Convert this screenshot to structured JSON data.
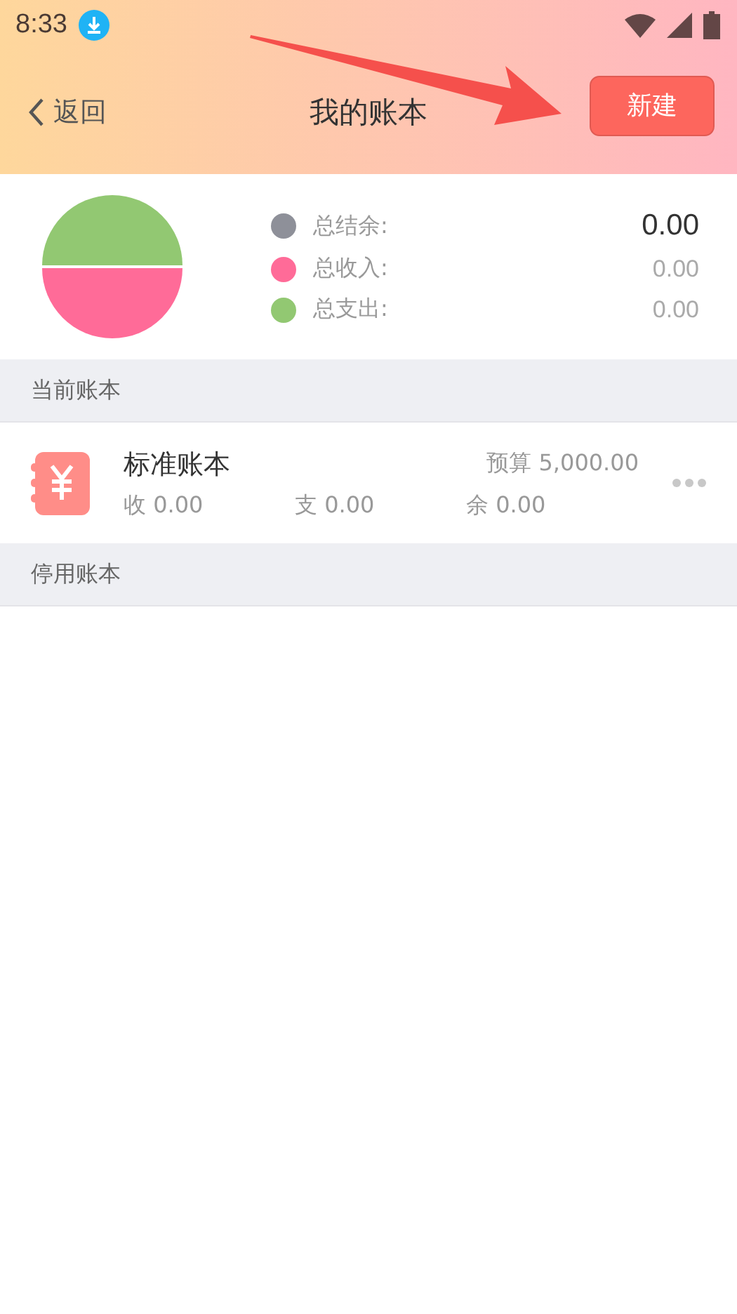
{
  "status_bar": {
    "time": "8:33"
  },
  "nav": {
    "back": "返回",
    "title": "我的账本",
    "new_button": "新建"
  },
  "summary": {
    "legend": [
      {
        "label": "总结余:",
        "value": "0.00",
        "color": "#8e9099",
        "kind": "main"
      },
      {
        "label": "总收入:",
        "value": "0.00",
        "color": "#ff6b98",
        "kind": "minor"
      },
      {
        "label": "总支出:",
        "value": "0.00",
        "color": "#92c872",
        "kind": "minor"
      }
    ]
  },
  "sections": [
    {
      "title": "当前账本",
      "books": [
        {
          "name": "标准账本",
          "budget": "预算 5,000.00",
          "income": "收 0.00",
          "expense": "支 0.00",
          "balance": "余 0.00"
        }
      ]
    },
    {
      "title": "停用账本"
    }
  ]
}
